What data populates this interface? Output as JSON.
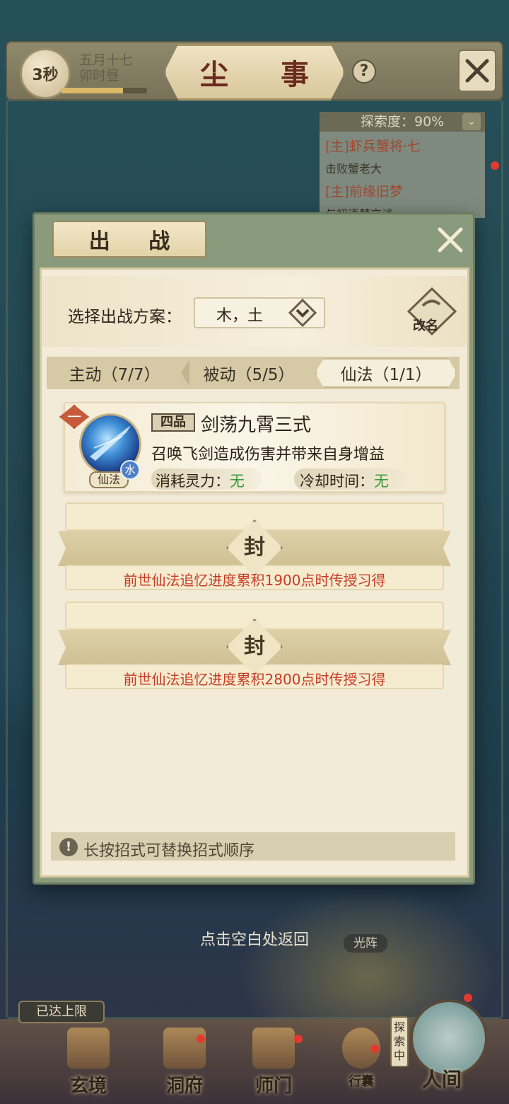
{
  "header": {
    "timer": "3秒",
    "date_line1": "五月十七",
    "date_line2": "卯时昼",
    "time_progress": 0.72,
    "title": "尘 事",
    "help_symbol": "?"
  },
  "quest_panel": {
    "explore_label": "探索度：90%",
    "quests": [
      {
        "title": "[主]虾兵蟹将·七",
        "subtitle": "击败蟹老大"
      },
      {
        "title": "[主]前缘旧梦",
        "subtitle": "与初语梦交谈"
      }
    ]
  },
  "dialog": {
    "title": "出 战",
    "plan_label": "选择出战方案：",
    "plan_value": "木，土",
    "rename_label": "改名",
    "tabs": [
      {
        "label": "主动（7/7）",
        "active": false
      },
      {
        "label": "被动（5/5）",
        "active": false
      },
      {
        "label": "仙法（1/1）",
        "active": true
      }
    ],
    "skill": {
      "slot": "一",
      "grade": "四品",
      "name": "剑荡九霄三式",
      "description": "召唤飞剑造成伤害并带来自身增益",
      "type_tag": "仙法",
      "element": "水",
      "cost_label": "消耗灵力：",
      "cost_value": "无",
      "cooldown_label": "冷却时间：",
      "cooldown_value": "无"
    },
    "locked_slots": [
      {
        "seal": "封",
        "text": "前世仙法追忆进度累积1900点时传授习得"
      },
      {
        "seal": "封",
        "text": "前世仙法追忆进度累积2800点时传授习得"
      }
    ],
    "tip_icon": "!",
    "tip": "长按招式可替换招式顺序"
  },
  "tap_return": "点击空白处返回",
  "guangzhen": "光阵",
  "bottom_nav": {
    "limit_badge": "已达上限",
    "explore_tag": "探索中",
    "items": [
      {
        "label": "玄境"
      },
      {
        "label": "洞府"
      },
      {
        "label": "师门"
      },
      {
        "label": "行囊"
      },
      {
        "label": "人间"
      }
    ]
  },
  "colors": {
    "accent_red": "#c63b26",
    "green_value": "#3d9b3a",
    "panel_bg": "#f2ebd8"
  }
}
